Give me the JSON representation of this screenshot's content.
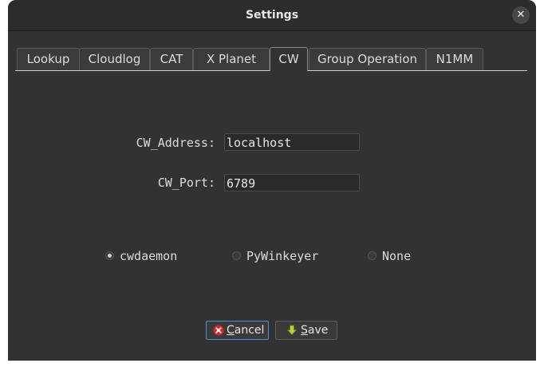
{
  "window": {
    "title": "Settings"
  },
  "tabs": [
    {
      "label": "Lookup"
    },
    {
      "label": "Cloudlog"
    },
    {
      "label": "CAT"
    },
    {
      "label": "X Planet"
    },
    {
      "label": "CW"
    },
    {
      "label": "Group Operation"
    },
    {
      "label": "N1MM"
    }
  ],
  "active_tab": "CW",
  "form": {
    "address_label": "CW_Address:",
    "address_value": "localhost",
    "port_label": "CW_Port:",
    "port_value": "6789"
  },
  "radios": [
    {
      "label": "cwdaemon",
      "checked": true
    },
    {
      "label": "PyWinkeyer",
      "checked": false
    },
    {
      "label": "None",
      "checked": false
    }
  ],
  "buttons": {
    "cancel_mnemonic": "C",
    "cancel_rest": "ancel",
    "save_mnemonic": "S",
    "save_rest": "ave"
  },
  "colors": {
    "window_bg": "#323232",
    "focus_border": "#4a90d9",
    "cancel_icon": "#d8262b",
    "save_icon": "#b8d13a"
  }
}
